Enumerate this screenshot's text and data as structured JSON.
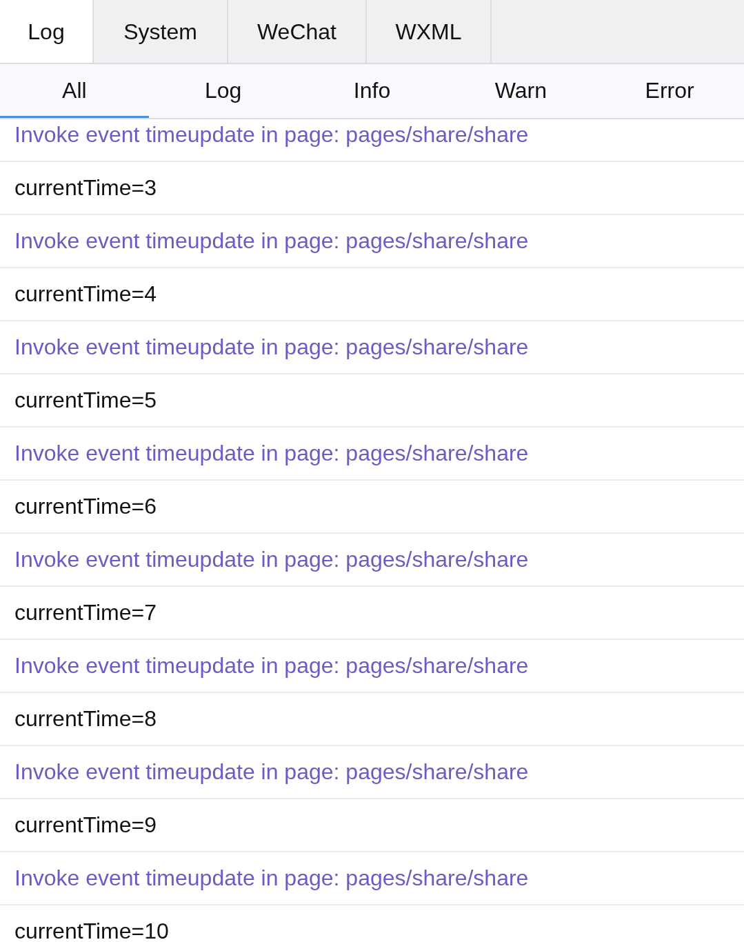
{
  "tabs": [
    {
      "label": "Log",
      "selected": true
    },
    {
      "label": "System",
      "selected": false
    },
    {
      "label": "WeChat",
      "selected": false
    },
    {
      "label": "WXML",
      "selected": false
    }
  ],
  "filters": [
    {
      "label": "All",
      "selected": true
    },
    {
      "label": "Log",
      "selected": false
    },
    {
      "label": "Info",
      "selected": false
    },
    {
      "label": "Warn",
      "selected": false
    },
    {
      "label": "Error",
      "selected": false
    }
  ],
  "entries": [
    {
      "kind": "info",
      "text": "Invoke event timeupdate in page: pages/share/share"
    },
    {
      "kind": "log",
      "text": "currentTime=3"
    },
    {
      "kind": "info",
      "text": "Invoke event timeupdate in page: pages/share/share"
    },
    {
      "kind": "log",
      "text": "currentTime=4"
    },
    {
      "kind": "info",
      "text": "Invoke event timeupdate in page: pages/share/share"
    },
    {
      "kind": "log",
      "text": "currentTime=5"
    },
    {
      "kind": "info",
      "text": "Invoke event timeupdate in page: pages/share/share"
    },
    {
      "kind": "log",
      "text": "currentTime=6"
    },
    {
      "kind": "info",
      "text": "Invoke event timeupdate in page: pages/share/share"
    },
    {
      "kind": "log",
      "text": "currentTime=7"
    },
    {
      "kind": "info",
      "text": "Invoke event timeupdate in page: pages/share/share"
    },
    {
      "kind": "log",
      "text": "currentTime=8"
    },
    {
      "kind": "info",
      "text": "Invoke event timeupdate in page: pages/share/share"
    },
    {
      "kind": "log",
      "text": "currentTime=9"
    },
    {
      "kind": "info",
      "text": "Invoke event timeupdate in page: pages/share/share"
    },
    {
      "kind": "log",
      "text": "currentTime=10"
    }
  ]
}
